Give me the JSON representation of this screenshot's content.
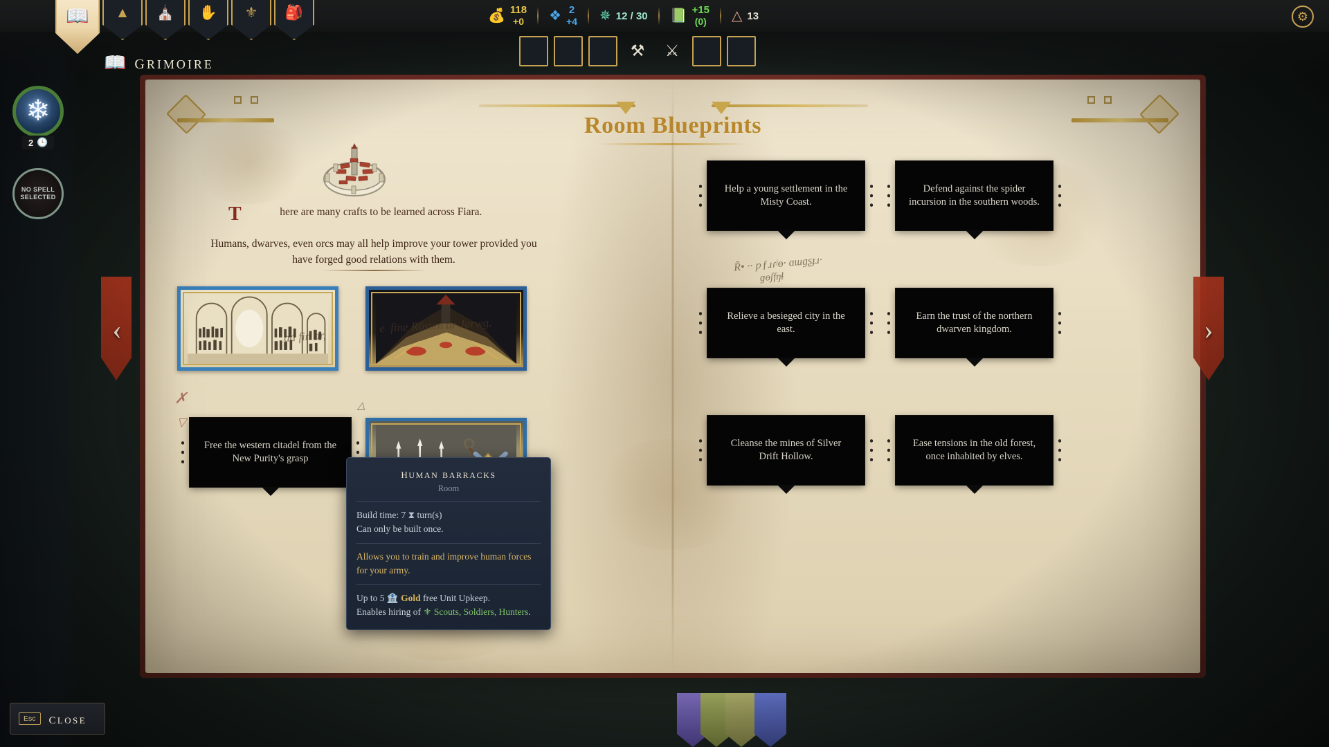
{
  "nav": {
    "tabs": [
      {
        "name": "grimoire",
        "icon": "open-book-icon",
        "glyph": "📖",
        "active": true
      },
      {
        "name": "tower",
        "icon": "triangle-stack-icon",
        "glyph": "▲",
        "active": false
      },
      {
        "name": "keep",
        "icon": "gate-icon",
        "glyph": "⛩",
        "active": false
      },
      {
        "name": "diplomacy",
        "icon": "offering-hand-icon",
        "glyph": "✋",
        "active": false
      },
      {
        "name": "units",
        "icon": "barracks-icon",
        "glyph": "⚜",
        "active": false
      },
      {
        "name": "inventory",
        "icon": "potion-bag-icon",
        "glyph": "🎒",
        "active": false
      }
    ]
  },
  "header": {
    "title": "Grimoire",
    "title_icon": "open-book-icon",
    "settings_icon": "gear-icon"
  },
  "resources": [
    {
      "id": "gold",
      "icon": "treasure-chest-icon",
      "glyph": "🧰",
      "value": "118",
      "delta": "+0",
      "color": "#e8c84a"
    },
    {
      "id": "mana",
      "icon": "blue-crystal-icon",
      "glyph": "❖",
      "value": "2",
      "delta": "+4",
      "color": "#4aa6e8"
    },
    {
      "id": "arcana",
      "icon": "pentagram-knot-icon",
      "glyph": "✪",
      "value": "12 / 30",
      "delta": "",
      "color": "#66d9b0"
    },
    {
      "id": "research",
      "icon": "green-tome-icon",
      "glyph": "📗",
      "value": "+15",
      "delta": "(0)",
      "color": "#6ddb52"
    },
    {
      "id": "threat",
      "icon": "red-triangle-icon",
      "glyph": "▲",
      "value": "13",
      "delta": "",
      "color": "#e3a08c"
    }
  ],
  "slots": [
    {
      "id": "slot-1",
      "type": "empty",
      "glyph": ""
    },
    {
      "id": "slot-2",
      "type": "empty",
      "glyph": ""
    },
    {
      "id": "slot-3",
      "type": "empty",
      "glyph": ""
    },
    {
      "id": "slot-4",
      "type": "icon",
      "icon": "hammer-pick-icon",
      "glyph": "⚒"
    },
    {
      "id": "slot-5",
      "type": "icon",
      "icon": "banner-standard-icon",
      "glyph": "⚑"
    },
    {
      "id": "slot-6",
      "type": "empty",
      "glyph": ""
    },
    {
      "id": "slot-7",
      "type": "empty",
      "glyph": ""
    }
  ],
  "spells": {
    "active": {
      "name": "frost-spell",
      "icon": "snowflake-icon",
      "glyph": "❄",
      "badge_count": "2",
      "badge_icon": "clock-icon",
      "badge_glyph": "🕐"
    },
    "empty": {
      "label_line1": "NO SPELL",
      "label_line2": "SELECTED"
    }
  },
  "book": {
    "page_title": "Room Blueprints",
    "left_page": {
      "illustration": "walled-town-illustration",
      "intro_dropcap": "T",
      "intro_text": "here are many crafts to be learned across Fiara.",
      "intro_text2": "Humans, dwarves, even orcs may all help improve your tower provided you have forged  good relations with them.",
      "blueprints": [
        {
          "id": "library-blueprint",
          "alt": "library interior with arched bookshelves"
        },
        {
          "id": "forge-blueprint",
          "alt": "dark cavern forge with red flames"
        },
        {
          "id": "barracks-blueprint",
          "alt": "human barracks with spears and crossed swords"
        }
      ],
      "quest": "Free the western citadel from the New Purity's grasp",
      "scribbles": [
        "ad fin ar,",
        "e  fine Rösten ar Jarwg."
      ]
    },
    "quests": [
      "Help a young settlement in the Misty Coast.",
      "Defend against the spider incursion in the southern woods.",
      "Relieve a besieged city in the east.",
      "Earn the trust of the northern dwarven kingdom.",
      "Cleanse the mines of Silver Drift Hollow.",
      "Ease tensions in the old forest, once inhabited by elves."
    ],
    "nav_prev_icon": "chevron-left-icon",
    "nav_prev_glyph": "‹",
    "nav_next_icon": "chevron-right-icon",
    "nav_next_glyph": "›"
  },
  "tooltip": {
    "title": "Human Barracks",
    "subtitle": "Room",
    "build_time_label": "Build time: 7",
    "build_time_icon": "hourglass-icon",
    "build_time_glyph": "⧗",
    "build_time_suffix": "turn(s)",
    "once_note": "Can only be built once.",
    "description": "Allows you to train and improve human forces for your army.",
    "upkeep_prefix": "Up to 5",
    "upkeep_icon": "gold-coin-icon",
    "upkeep_glyph": "🪙",
    "upkeep_gold": "Gold",
    "upkeep_suffix": "free Unit Upkeep.",
    "hiring_prefix": "Enables hiring of",
    "hiring_icon": "unit-crest-icon",
    "hiring_glyph": "♕",
    "hiring_units": "Scouts, Soldiers, Hunters",
    "hiring_end": "."
  },
  "footer": {
    "close_key": "Esc",
    "close_label": "Close"
  },
  "banners": [
    {
      "id": "banner-purple",
      "color": "#6b5aa8",
      "glyph": "✶"
    },
    {
      "id": "banner-green",
      "color": "#7d8c4a",
      "glyph": "☘"
    },
    {
      "id": "banner-olive",
      "color": "#8a8b4e",
      "glyph": "☙"
    },
    {
      "id": "banner-blue",
      "color": "#4a5aa8",
      "glyph": "⚔"
    }
  ]
}
